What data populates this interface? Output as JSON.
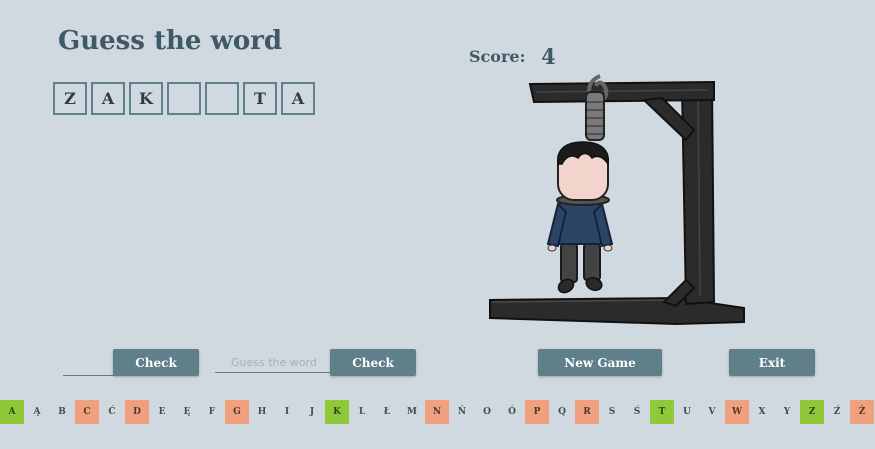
{
  "game": {
    "title": "Guess the word",
    "score_label": "Score:",
    "score_value": "4"
  },
  "word": {
    "slots": [
      "Z",
      "A",
      "K",
      "",
      "",
      "T",
      "A"
    ]
  },
  "controls": {
    "check_letter_label": "Check",
    "letter_input_value": "",
    "guess_placeholder": "Guess the word",
    "guess_value": "",
    "check_word_label": "Check",
    "new_game_label": "New Game",
    "exit_label": "Exit"
  },
  "alphabet": [
    {
      "letter": "A",
      "state": "correct"
    },
    {
      "letter": "Ą",
      "state": "unused"
    },
    {
      "letter": "B",
      "state": "unused"
    },
    {
      "letter": "C",
      "state": "wrong"
    },
    {
      "letter": "Ć",
      "state": "unused"
    },
    {
      "letter": "D",
      "state": "wrong"
    },
    {
      "letter": "E",
      "state": "unused"
    },
    {
      "letter": "Ę",
      "state": "unused"
    },
    {
      "letter": "F",
      "state": "unused"
    },
    {
      "letter": "G",
      "state": "wrong"
    },
    {
      "letter": "H",
      "state": "unused"
    },
    {
      "letter": "I",
      "state": "unused"
    },
    {
      "letter": "J",
      "state": "unused"
    },
    {
      "letter": "K",
      "state": "correct"
    },
    {
      "letter": "L",
      "state": "unused"
    },
    {
      "letter": "Ł",
      "state": "unused"
    },
    {
      "letter": "M",
      "state": "unused"
    },
    {
      "letter": "N",
      "state": "wrong"
    },
    {
      "letter": "Ń",
      "state": "unused"
    },
    {
      "letter": "O",
      "state": "unused"
    },
    {
      "letter": "Ó",
      "state": "unused"
    },
    {
      "letter": "P",
      "state": "wrong"
    },
    {
      "letter": "Q",
      "state": "unused"
    },
    {
      "letter": "R",
      "state": "wrong"
    },
    {
      "letter": "S",
      "state": "unused"
    },
    {
      "letter": "Ś",
      "state": "unused"
    },
    {
      "letter": "T",
      "state": "correct"
    },
    {
      "letter": "U",
      "state": "unused"
    },
    {
      "letter": "V",
      "state": "unused"
    },
    {
      "letter": "W",
      "state": "wrong"
    },
    {
      "letter": "X",
      "state": "unused"
    },
    {
      "letter": "Y",
      "state": "unused"
    },
    {
      "letter": "Z",
      "state": "correct"
    },
    {
      "letter": "Ź",
      "state": "unused"
    },
    {
      "letter": "Ż",
      "state": "wrong"
    }
  ],
  "colors": {
    "background": "#d0d9df",
    "accent": "#5f7f8b",
    "title": "#3f5a66",
    "correct": "#8fc93a",
    "wrong": "#f0a07c"
  }
}
